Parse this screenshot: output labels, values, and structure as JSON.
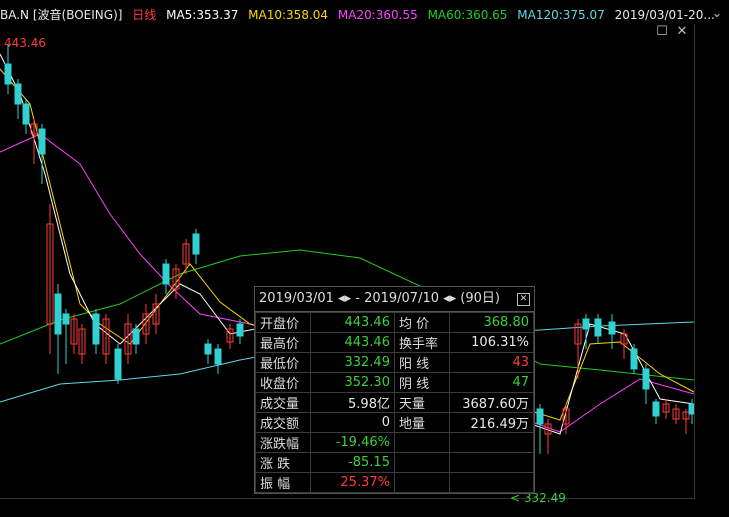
{
  "legend": {
    "symbol": "BA.N [波音(BOEING)]",
    "period": "日线",
    "ma5": "MA5:353.37",
    "ma10": "MA10:358.04",
    "ma20": "MA20:360.55",
    "ma60": "MA60:360.65",
    "ma120": "MA120:375.07",
    "range": "2019/03/01-20..."
  },
  "colors": {
    "up": "#ff3b3b",
    "down": "#32d0d0",
    "ma5": "#ffffff",
    "ma10": "#ffd400",
    "ma20": "#ff40ff",
    "ma60": "#22cc22",
    "ma120": "#5ed8e8"
  },
  "chart": {
    "high_label": "443.46",
    "low_label": "332.49"
  },
  "tooltip": {
    "title": "2019/03/01 ◂▸ - 2019/07/10 ◂▸ (90日)",
    "rows": [
      {
        "k1": "开盘价",
        "v1": "443.46",
        "c1": "green",
        "k2": "均  价",
        "v2": "368.80",
        "c2": "green"
      },
      {
        "k1": "最高价",
        "v1": "443.46",
        "c1": "green",
        "k2": "换手率",
        "v2": "106.31%",
        "c2": "white"
      },
      {
        "k1": "最低价",
        "v1": "332.49",
        "c1": "green",
        "k2": "阳  线",
        "v2": "43",
        "c2": "red"
      },
      {
        "k1": "收盘价",
        "v1": "352.30",
        "c1": "green",
        "k2": "阴  线",
        "v2": "47",
        "c2": "green"
      },
      {
        "k1": "成交量",
        "v1": "5.98亿",
        "c1": "white",
        "k2": "天量",
        "v2": "3687.60万",
        "c2": "white"
      },
      {
        "k1": "成交额",
        "v1": "0",
        "c1": "white",
        "k2": "地量",
        "v2": "216.49万",
        "c2": "white"
      },
      {
        "k1": "涨跌幅",
        "v1": "-19.46%",
        "c1": "green",
        "k2": "",
        "v2": "",
        "c2": "white"
      },
      {
        "k1": "涨  跌",
        "v1": "-85.15",
        "c1": "green",
        "k2": "",
        "v2": "",
        "c2": "white"
      },
      {
        "k1": "振  幅",
        "v1": "25.37%",
        "c1": "red",
        "k2": "",
        "v2": "",
        "c2": "white"
      }
    ]
  }
}
